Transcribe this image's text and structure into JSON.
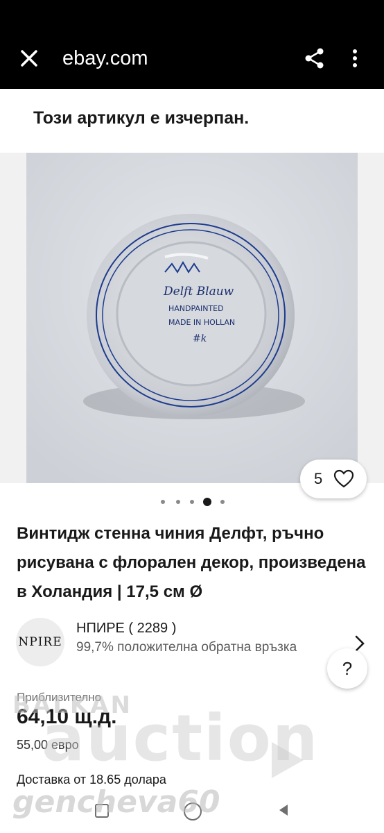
{
  "browser": {
    "url": "ebay.com"
  },
  "listing": {
    "sold_out_notice": "Този артикул е изчерпан.",
    "watch_count": "5",
    "title": "Винтидж стенна чиния Делфт, ръчно рисувана с флорален декор, произведена в Холандия | 17,5 см Ø",
    "approx_label": "Приблизително",
    "price": "64,10 щ.д.",
    "price_original": "55,00 евро",
    "shipping": "Доставка от 18.65 долара"
  },
  "plate_marks": {
    "line1": "Delft Blauw",
    "line2": "HANDPAINTED",
    "line3": "MADE IN HOLLAN",
    "line4": "#k"
  },
  "seller": {
    "logo_text": "NPIRE",
    "name": "НПИРЕ ( 2289 )",
    "feedback": "99,7% положителна обратна връзка"
  },
  "help_label": "?",
  "gallery_dots": {
    "count": 5,
    "active_index": 3
  },
  "watermark": {
    "top": "BALKAN",
    "main": "auction",
    "user": "genchevа60"
  },
  "colors": {
    "topbar": "#000000",
    "text": "#191919",
    "plate_blue": "#1c3b8f"
  }
}
